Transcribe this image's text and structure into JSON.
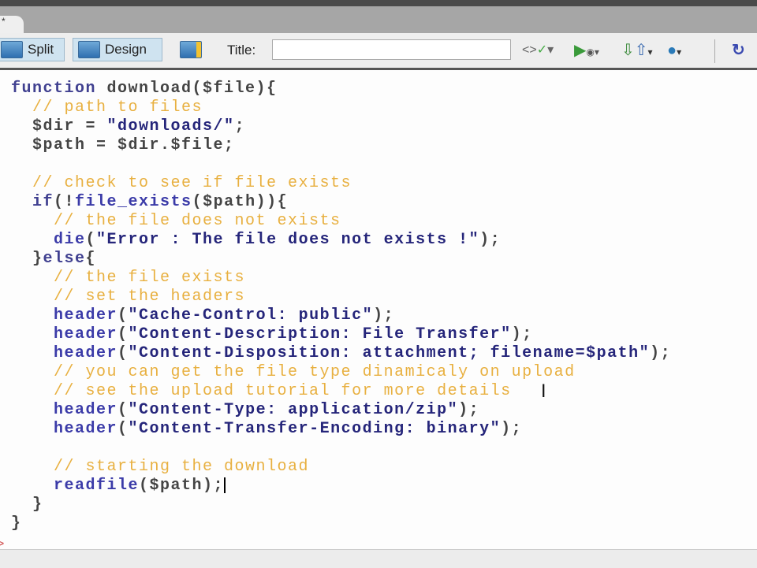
{
  "tab": {
    "label": "*"
  },
  "toolbar": {
    "split_label": "Split",
    "design_label": "Design",
    "title_label": "Title:",
    "title_value": "",
    "icons": [
      "validate-markup-icon",
      "preview-icon",
      "file-transfer-icon",
      "browser-check-icon",
      "refresh-icon"
    ]
  },
  "code": {
    "lines": [
      [
        [
          "kw",
          "function "
        ],
        [
          "tx",
          "download($file){"
        ]
      ],
      [
        [
          "cm",
          "  // path to files"
        ]
      ],
      [
        [
          "tx",
          "  $dir = "
        ],
        [
          "str",
          "\"downloads/\""
        ],
        [
          "tx",
          ";"
        ]
      ],
      [
        [
          "tx",
          "  $path = $dir.$file;"
        ]
      ],
      [],
      [
        [
          "cm",
          "  // check to see if file exists"
        ]
      ],
      [
        [
          "kw",
          "  if"
        ],
        [
          "tx",
          "(!"
        ],
        [
          "fn",
          "file_exists"
        ],
        [
          "tx",
          "($path)){"
        ]
      ],
      [
        [
          "cm",
          "    // the file does not exists"
        ]
      ],
      [
        [
          "fn",
          "    die"
        ],
        [
          "tx",
          "("
        ],
        [
          "str",
          "\"Error : The file does not exists !\""
        ],
        [
          "tx",
          ");"
        ]
      ],
      [
        [
          "tx",
          "  }"
        ],
        [
          "kw",
          "else"
        ],
        [
          "tx",
          "{"
        ]
      ],
      [
        [
          "cm",
          "    // the file exists"
        ]
      ],
      [
        [
          "cm",
          "    // set the headers"
        ]
      ],
      [
        [
          "fn",
          "    header"
        ],
        [
          "tx",
          "("
        ],
        [
          "str",
          "\"Cache-Control: public\""
        ],
        [
          "tx",
          ");"
        ]
      ],
      [
        [
          "fn",
          "    header"
        ],
        [
          "tx",
          "("
        ],
        [
          "str",
          "\"Content-Description: File Transfer\""
        ],
        [
          "tx",
          ");"
        ]
      ],
      [
        [
          "fn",
          "    header"
        ],
        [
          "tx",
          "("
        ],
        [
          "str",
          "\"Content-Disposition: attachment; filename=$path\""
        ],
        [
          "tx",
          ");"
        ]
      ],
      [
        [
          "cm",
          "    // you can get the file type dinamicaly on upload"
        ]
      ],
      [
        [
          "cm",
          "    // see the upload tutorial for more details"
        ]
      ],
      [
        [
          "fn",
          "    header"
        ],
        [
          "tx",
          "("
        ],
        [
          "str",
          "\"Content-Type: application/zip\""
        ],
        [
          "tx",
          ");"
        ]
      ],
      [
        [
          "fn",
          "    header"
        ],
        [
          "tx",
          "("
        ],
        [
          "str",
          "\"Content-Transfer-Encoding: binary\""
        ],
        [
          "tx",
          ");"
        ]
      ],
      [],
      [
        [
          "cm",
          "    // starting the download"
        ]
      ],
      [
        [
          "fn",
          "    readfile"
        ],
        [
          "tx",
          "($path);"
        ]
      ],
      [
        [
          "tx",
          "  }"
        ]
      ],
      [
        [
          "tx",
          "}"
        ]
      ]
    ],
    "cursor_line": 21
  },
  "gutter": {
    "mark": ">"
  }
}
